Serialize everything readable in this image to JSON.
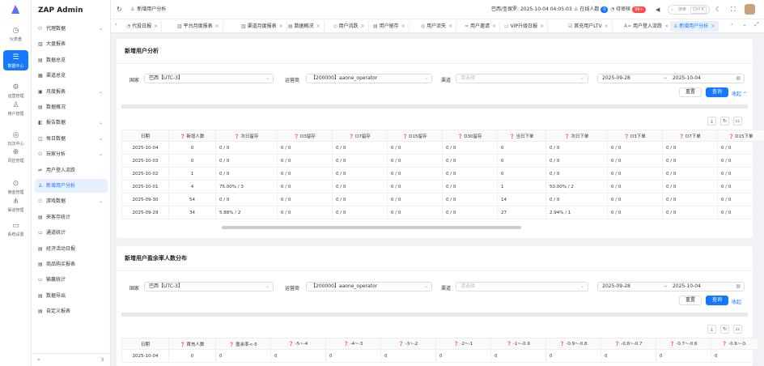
{
  "rail": [
    {
      "label": "仪表盘",
      "icon": "dashboard-icon"
    },
    {
      "label": "数据中心",
      "icon": "database-icon"
    },
    {
      "label": "运营管理",
      "icon": "operation-icon"
    },
    {
      "label": "用户管理",
      "icon": "user-icon"
    },
    {
      "label": "玩法中心",
      "icon": "game-icon"
    },
    {
      "label": "风控管理",
      "icon": "globe-icon"
    },
    {
      "label": "佣金管理",
      "icon": "pin-icon"
    },
    {
      "label": "渠道管理",
      "icon": "share-icon"
    },
    {
      "label": "系统设置",
      "icon": "message-icon"
    }
  ],
  "brand": "ZAP Admin",
  "menu": [
    {
      "label": "代理数据",
      "icon": "proxy-icon",
      "chev": "⌄"
    },
    {
      "label": "大盘报表",
      "icon": "bar-chart-icon",
      "chev": ""
    },
    {
      "label": "数据总览",
      "icon": "overview-icon",
      "chev": ""
    },
    {
      "label": "渠道总览",
      "icon": "grid-icon",
      "chev": ""
    },
    {
      "label": "月度报表",
      "icon": "calendar-icon",
      "chev": "⌄"
    },
    {
      "label": "数据概况",
      "icon": "summary-icon",
      "chev": ""
    },
    {
      "label": "报告数据",
      "icon": "report-icon",
      "chev": "⌄"
    },
    {
      "label": "每日数据",
      "icon": "daily-icon",
      "chev": "⌄"
    },
    {
      "label": "玩家分析",
      "icon": "player-icon",
      "chev": "⌄"
    },
    {
      "label": "用户登入流跌",
      "icon": "login-icon",
      "chev": ""
    },
    {
      "label": "新增用户分析",
      "icon": "new-user-icon",
      "chev": ""
    },
    {
      "label": "游戏数据",
      "icon": "game-data-icon",
      "chev": "⌄"
    },
    {
      "label": "来客存统计",
      "icon": "deposit-icon",
      "chev": ""
    },
    {
      "label": "通道统计",
      "icon": "channel-icon",
      "chev": ""
    },
    {
      "label": "经济活动日报",
      "icon": "economy-icon",
      "chev": ""
    },
    {
      "label": "商品购买报表",
      "icon": "shop-icon",
      "chev": ""
    },
    {
      "label": "输赢统计",
      "icon": "win-loss-icon",
      "chev": ""
    },
    {
      "label": "数据导出",
      "icon": "export-icon",
      "chev": ""
    },
    {
      "label": "自定义报表",
      "icon": "custom-report-icon",
      "chev": ""
    }
  ],
  "topbar": {
    "breadcrumb": "新增用户分析",
    "time": "巴西/圣保罗: 2025-10-04 04:05:03",
    "online_label": "在线人数",
    "online_count": "0",
    "pending_label": "待审核",
    "pending_count": "99+",
    "search_placeholder": "搜索",
    "search_kbd": "Ctrl K"
  },
  "tabs": [
    {
      "label": "代投日报"
    },
    {
      "label": "平台月度报表"
    },
    {
      "label": "渠道月度报表"
    },
    {
      "label": "数据概况"
    },
    {
      "label": "用户流跌"
    },
    {
      "label": "用户留存"
    },
    {
      "label": "用户流失"
    },
    {
      "label": "用户邀请"
    },
    {
      "label": "VIP升级日报"
    },
    {
      "label": "首充用户LTV"
    },
    {
      "label": "用户登入流跌"
    },
    {
      "label": "新增用户分析"
    }
  ],
  "card1": {
    "title": "新增用户分析",
    "country_label": "国家",
    "country_value": "巴西【UTC-3】",
    "operator_label": "运营商",
    "operator_value": "【200000】aaone_operator",
    "channel_label": "渠道",
    "channel_placeholder": "请选择",
    "date_start": "2025-09-28",
    "date_sep": "→",
    "date_end": "2025-10-04",
    "reset": "重置",
    "query": "查询",
    "collapse": "收起 ^",
    "columns": [
      "日期",
      "新增人数",
      "次日留存",
      "D3留存",
      "D7留存",
      "D15留存",
      "D30留存",
      "当日下单",
      "次日下单",
      "D3下单",
      "D7下单",
      "D15下单"
    ],
    "rows": [
      [
        "2025-10-04",
        "0",
        "0 / 0",
        "0 / 0",
        "0 / 0",
        "0 / 0",
        "0 / 0",
        "0",
        "0 / 0",
        "0 / 0",
        "0 / 0",
        "0 / 0"
      ],
      [
        "2025-10-03",
        "0",
        "0 / 0",
        "0 / 0",
        "0 / 0",
        "0 / 0",
        "0 / 0",
        "0",
        "0 / 0",
        "0 / 0",
        "0 / 0",
        "0 / 0"
      ],
      [
        "2025-10-02",
        "1",
        "0 / 0",
        "0 / 0",
        "0 / 0",
        "0 / 0",
        "0 / 0",
        "0",
        "0 / 0",
        "0 / 0",
        "0 / 0",
        "0 / 0"
      ],
      [
        "2025-10-01",
        "4",
        "75.00% / 3",
        "0 / 0",
        "0 / 0",
        "0 / 0",
        "0 / 0",
        "1",
        "50.00% / 2",
        "0 / 0",
        "0 / 0",
        "0 / 0"
      ],
      [
        "2025-09-30",
        "54",
        "0 / 0",
        "0 / 0",
        "0 / 0",
        "0 / 0",
        "0 / 0",
        "14",
        "0 / 0",
        "0 / 0",
        "0 / 0",
        "0 / 0"
      ],
      [
        "2025-09-29",
        "34",
        "5.88% / 2",
        "0 / 0",
        "0 / 0",
        "0 / 0",
        "0 / 0",
        "27",
        "2.94% / 1",
        "0 / 0",
        "0 / 0",
        "0 / 0"
      ]
    ]
  },
  "card2": {
    "title": "新增用户盈余率人数分布",
    "country_label": "国家",
    "country_value": "巴西【UTC-3】",
    "operator_label": "运营商",
    "operator_value": "【200000】aaone_operator",
    "channel_label": "渠道",
    "channel_placeholder": "请选择",
    "date_start": "2025-09-28",
    "date_sep": "→",
    "date_end": "2025-10-04",
    "reset": "重置",
    "query": "查询",
    "collapse": "收起",
    "columns": [
      "日期",
      "首充人数",
      "盈余率<-5",
      "-5~-4",
      "-4~-3",
      "-3~-2",
      "-2~-1",
      "-1~-0.9",
      "-0.9~-0.8",
      "-0.8~-0.7",
      "-0.7~-0.6",
      "-0.6~-0."
    ],
    "rows": [
      [
        "2025-10-04",
        "0",
        "0",
        "0",
        "0",
        "0",
        "0",
        "0",
        "0",
        "0",
        "0",
        "0"
      ]
    ]
  }
}
